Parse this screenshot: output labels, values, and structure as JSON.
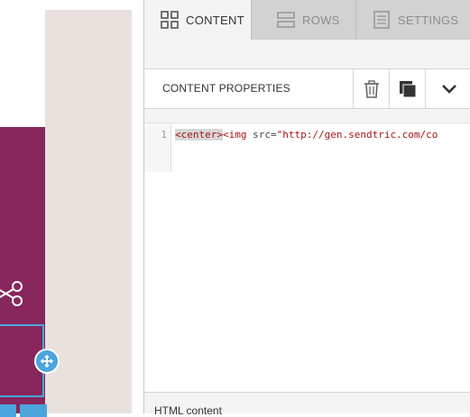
{
  "tabs": [
    {
      "label": "CONTENT",
      "icon": "grid-icon",
      "active": true
    },
    {
      "label": "ROWS",
      "icon": "rows-icon",
      "active": false
    },
    {
      "label": "SETTINGS",
      "icon": "settings-icon",
      "active": false
    }
  ],
  "properties": {
    "title": "CONTENT PROPERTIES",
    "actions": [
      "trash-icon",
      "duplicate-icon",
      "chevron-down-icon"
    ]
  },
  "editor": {
    "line_number": "1",
    "code": {
      "tag_open": "<center>",
      "tag_img": "<img",
      "attr": " src=",
      "value": "\"http://gen.sendtric.com/co"
    }
  },
  "html_label": "HTML content",
  "canvas": {
    "block_color": "#87275c",
    "accent_color": "#4aa5dc",
    "strip_color": "#e8e1dd"
  }
}
